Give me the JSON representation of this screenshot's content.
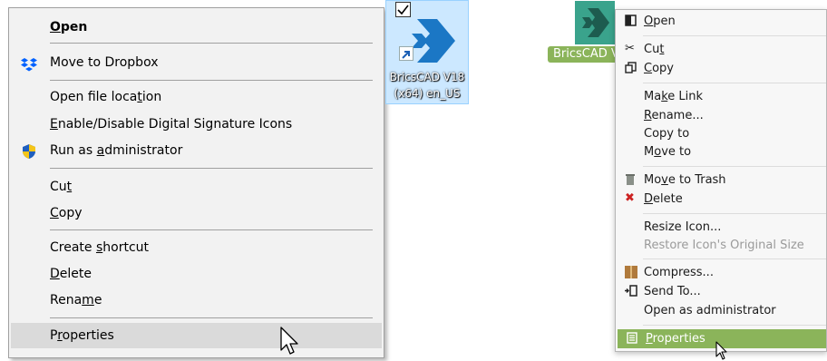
{
  "windows_menu": {
    "items": [
      {
        "id": "open",
        "before": "",
        "u": "O",
        "after": "pen"
      },
      {
        "id": "dropbox",
        "before": "Move to Dropbox",
        "u": "",
        "after": ""
      },
      {
        "id": "open_location",
        "before": "Open file loca",
        "u": "t",
        "after": "ion"
      },
      {
        "id": "sig_icons",
        "before": "",
        "u": "E",
        "after": "nable/Disable Digital Signature Icons"
      },
      {
        "id": "run_admin",
        "before": "Run as ",
        "u": "a",
        "after": "dministrator"
      },
      {
        "id": "cut",
        "before": "Cu",
        "u": "t",
        "after": ""
      },
      {
        "id": "copy",
        "before": "",
        "u": "C",
        "after": "opy"
      },
      {
        "id": "create_shortcut",
        "before": "Create ",
        "u": "s",
        "after": "hortcut"
      },
      {
        "id": "delete",
        "before": "",
        "u": "D",
        "after": "elete"
      },
      {
        "id": "rename",
        "before": "Rena",
        "u": "m",
        "after": "e"
      },
      {
        "id": "properties",
        "before": "P",
        "u": "r",
        "after": "operties"
      }
    ]
  },
  "desktop_icon": {
    "caption_line1": "BricsCAD V18",
    "caption_line2": "(x64) en_US"
  },
  "linux_icon": {
    "caption": "BricsCAD V"
  },
  "linux_menu": {
    "items": [
      {
        "id": "open",
        "before": "",
        "u": "O",
        "after": "pen"
      },
      {
        "id": "cut",
        "before": "Cu",
        "u": "t",
        "after": ""
      },
      {
        "id": "copy",
        "before": "",
        "u": "C",
        "after": "opy"
      },
      {
        "id": "make_link",
        "before": "Ma",
        "u": "k",
        "after": "e Link"
      },
      {
        "id": "rename",
        "before": "",
        "u": "R",
        "after": "ename..."
      },
      {
        "id": "copy_to",
        "before": "Copy to",
        "u": "",
        "after": ""
      },
      {
        "id": "move_to",
        "before": "M",
        "u": "o",
        "after": "ve to"
      },
      {
        "id": "move_trash",
        "before": "Mo",
        "u": "v",
        "after": "e to Trash"
      },
      {
        "id": "delete",
        "before": "",
        "u": "D",
        "after": "elete"
      },
      {
        "id": "resize_icon",
        "before": "Resize Icon...",
        "u": "",
        "after": ""
      },
      {
        "id": "restore_icon",
        "before": "Restore Icon's Original Size",
        "u": "",
        "after": ""
      },
      {
        "id": "compress",
        "before": "Compress...",
        "u": "",
        "after": ""
      },
      {
        "id": "send_to",
        "before": "Send To...",
        "u": "",
        "after": ""
      },
      {
        "id": "open_admin",
        "before": "Open as administrator",
        "u": "",
        "after": ""
      },
      {
        "id": "properties",
        "before": "",
        "u": "P",
        "after": "roperties"
      }
    ]
  },
  "colors": {
    "windows_menu_bg": "#f2f2f2",
    "windows_hover": "#dadada",
    "desktop_select": "#cce8ff",
    "bricscad_blue": "#1b77c5",
    "bricscad_green": "#3aa38c",
    "linux_accent": "#8bb45a",
    "delete_red": "#cc2222"
  }
}
